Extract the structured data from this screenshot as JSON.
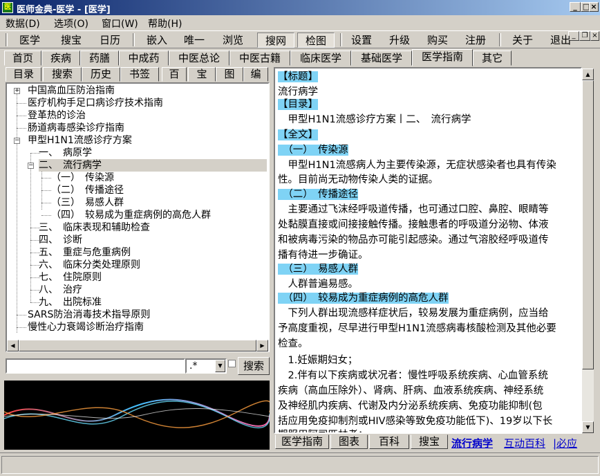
{
  "window": {
    "title": "医师金典-医学 - [医学]",
    "icon": "app-icon"
  },
  "menu": {
    "items": [
      "数据(D)",
      "选项(O)",
      "窗口(W)",
      "帮助(H)"
    ]
  },
  "toolbar": {
    "items": [
      "医学",
      "搜宝",
      "日历",
      "嵌入",
      "唯一",
      "浏览",
      "搜网",
      "检图",
      "设置",
      "升级",
      "购买",
      "注册",
      "关于",
      "退出"
    ]
  },
  "main_tabs": [
    "首页",
    "疾病",
    "药膳",
    "中成药",
    "中医总论",
    "中医古籍",
    "临床医学",
    "基础医学",
    "医学指南",
    "其它"
  ],
  "panel_tabs": [
    "目录",
    "搜索",
    "历史",
    "书签"
  ],
  "panel_icon_tabs": [
    "百",
    "宝",
    "图",
    "编"
  ],
  "tree": [
    "中国高血压防治指南",
    "医疗机构手足口病诊疗技术指南",
    "登革热的诊治",
    "肠道病毒感染诊疗指南",
    "甲型H1N1流感诊疗方案",
    "一、　病原学",
    "二、　流行病学",
    "（一）　传染源",
    "（二）　传播途径",
    "（三）　易感人群",
    "（四）　较易成为重症病例的高危人群",
    "三、　临床表现和辅助检查",
    "四、　诊断",
    "五、　重症与危重病例",
    "六、　临床分类处理原则",
    "七、　住院原则",
    "八、　治疗",
    "九、　出院标准",
    "SARS防治消毒技术指导原则",
    "慢性心力衰竭诊断治疗指南"
  ],
  "search": {
    "value": "",
    "regex_value": ".*",
    "button": "搜索"
  },
  "content": {
    "lines": [
      "【标题】",
      "流行病学",
      "【目录】",
      "　甲型H1N1流感诊疗方案丨二、　流行病学",
      "【全文】",
      "　（一）　传染源",
      "　甲型H1N1流感病人为主要传染源，无症状感染者也具有传染",
      "性。目前尚无动物传染人类的证据。",
      "　（二）　传播途径",
      "　主要通过飞沫经呼吸道传播，也可通过口腔、鼻腔、眼睛等",
      "处黏膜直接或间接接触传播。接触患者的呼吸道分泌物、体液",
      "和被病毒污染的物品亦可能引起感染。通过气溶胶经呼吸道传",
      "播有待进一步确证。",
      "　（三）　易感人群",
      "　人群普遍易感。",
      "　（四）　较易成为重症病例的高危人群",
      "　下列人群出现流感样症状后，较易发展为重症病例，应当给",
      "予高度重视，尽早进行甲型H1N1流感病毒核酸检测及其他必要",
      "检查。",
      "　1.妊娠期妇女；",
      "　2.伴有以下疾病或状况者：慢性呼吸系统疾病、心血管系统",
      "疾病（高血压除外）、肾病、肝病、血液系统疾病、神经系统",
      "及神经肌内疾病、代谢及内分泌系统疾病、免疫功能抑制(包",
      "括应用免疫抑制剂或HIV感染等致免疫功能低下)、19岁以下长",
      "期服用阿司匹林者；"
    ]
  },
  "bottom_tabs": [
    "医学指南",
    "图表",
    "百科",
    "搜宝"
  ],
  "bottom_links": [
    "流行病学",
    "互动百科",
    "|必应"
  ],
  "colors": {
    "highlight": "#7fd3f5",
    "title_bar": "#0a246a",
    "link": "#0000cc"
  }
}
